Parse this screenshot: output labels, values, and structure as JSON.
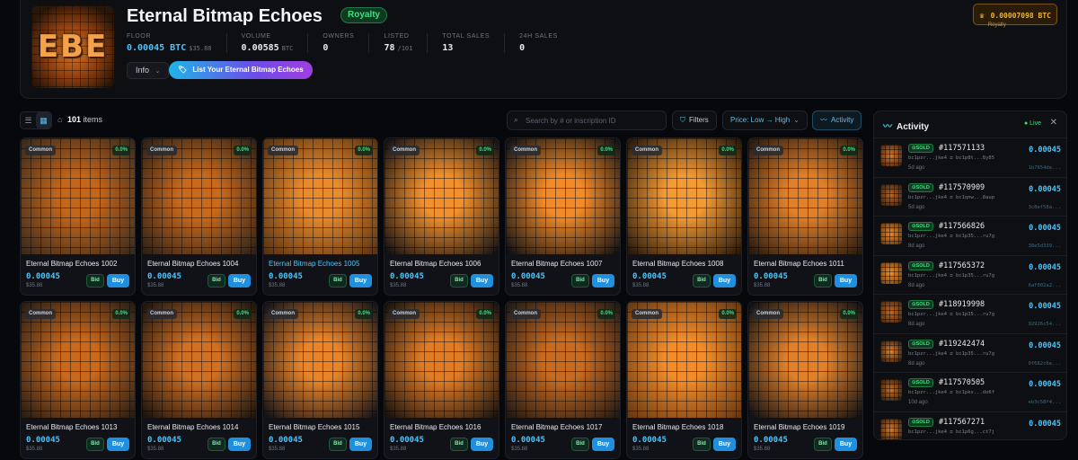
{
  "collection": {
    "title": "Eternal Bitmap Echoes",
    "logo_text": "EBE",
    "royalty_badge": "Royalty",
    "royalty_value": "0.00007098 BTC",
    "royalty_label": "Royalty",
    "info_label": "Info",
    "list_label": "List Your Eternal Bitmap Echoes"
  },
  "stats": [
    {
      "label": "FLOOR",
      "value": "0.00045 BTC",
      "sub": "$35.88"
    },
    {
      "label": "VOLUME",
      "value": "0.00585",
      "sub": "BTC"
    },
    {
      "label": "OWNERS",
      "value": "0",
      "sub": ""
    },
    {
      "label": "LISTED",
      "value": "78",
      "sub": "/101"
    },
    {
      "label": "TOTAL SALES",
      "value": "13",
      "sub": ""
    },
    {
      "label": "24H SALES",
      "value": "0",
      "sub": ""
    }
  ],
  "toolbar": {
    "items_count": "101",
    "items_suffix": "items",
    "search_placeholder": "Search by # or inscription ID",
    "filters_label": "Filters",
    "sort_label": "Price: Low → High",
    "activity_label": "Activity"
  },
  "colors": {
    "accent": "#4fc3f7",
    "green": "#3ee07e",
    "gold": "#f0b429"
  },
  "cards": [
    {
      "name": "Eternal Bitmap Echoes 1002",
      "rarity": "Common",
      "pct": "0.0%",
      "price": "0.00045",
      "usd": "$35.88",
      "bid": "Bid",
      "buy": "Buy",
      "highlight": false,
      "c1": "#c2661c",
      "c2": "#3a2a1c"
    },
    {
      "name": "Eternal Bitmap Echoes 1004",
      "rarity": "Common",
      "pct": "0.0%",
      "price": "0.00045",
      "usd": "$35.88",
      "bid": "Bid",
      "buy": "Buy",
      "highlight": false,
      "c1": "#c86a1e",
      "c2": "#2e2218"
    },
    {
      "name": "Eternal Bitmap Echoes 1005",
      "rarity": "Common",
      "pct": "0.0%",
      "price": "0.00045",
      "usd": "$35.88",
      "bid": "Bid",
      "buy": "Buy",
      "highlight": true,
      "c1": "#e88a2e",
      "c2": "#5a3412"
    },
    {
      "name": "Eternal Bitmap Echoes 1006",
      "rarity": "Common",
      "pct": "0.0%",
      "price": "0.00045",
      "usd": "$35.88",
      "bid": "Bid",
      "buy": "Buy",
      "highlight": false,
      "c1": "#f0902e",
      "c2": "#141214"
    },
    {
      "name": "Eternal Bitmap Echoes 1007",
      "rarity": "Common",
      "pct": "0.0%",
      "price": "0.00045",
      "usd": "$35.88",
      "bid": "Bid",
      "buy": "Buy",
      "highlight": false,
      "c1": "#f08a2a",
      "c2": "#121214"
    },
    {
      "name": "Eternal Bitmap Echoes 1008",
      "rarity": "Common",
      "pct": "0.0%",
      "price": "0.00045",
      "usd": "$35.88",
      "bid": "Bid",
      "buy": "Buy",
      "highlight": false,
      "c1": "#f29a36",
      "c2": "#2a1a0c"
    },
    {
      "name": "Eternal Bitmap Echoes 1011",
      "rarity": "Common",
      "pct": "0.0%",
      "price": "0.00045",
      "usd": "$35.88",
      "bid": "Bid",
      "buy": "Buy",
      "highlight": false,
      "c1": "#e0802a",
      "c2": "#2a1a10"
    },
    {
      "name": "Eternal Bitmap Echoes 1013",
      "rarity": "Common",
      "pct": "0.0%",
      "price": "0.00045",
      "usd": "$35.88",
      "bid": "Bid",
      "buy": "Buy",
      "highlight": false,
      "c1": "#c8691e",
      "c2": "#2a1e14"
    },
    {
      "name": "Eternal Bitmap Echoes 1014",
      "rarity": "Common",
      "pct": "0.0%",
      "price": "0.00045",
      "usd": "$35.88",
      "bid": "Bid",
      "buy": "Buy",
      "highlight": false,
      "c1": "#d07024",
      "c2": "#1e1610"
    },
    {
      "name": "Eternal Bitmap Echoes 1015",
      "rarity": "Common",
      "pct": "0.0%",
      "price": "0.00045",
      "usd": "$35.88",
      "bid": "Bid",
      "buy": "Buy",
      "highlight": false,
      "c1": "#e8842a",
      "c2": "#161418"
    },
    {
      "name": "Eternal Bitmap Echoes 1016",
      "rarity": "Common",
      "pct": "0.0%",
      "price": "0.00045",
      "usd": "$35.88",
      "bid": "Bid",
      "buy": "Buy",
      "highlight": false,
      "c1": "#e07c26",
      "c2": "#1a1410"
    },
    {
      "name": "Eternal Bitmap Echoes 1017",
      "rarity": "Common",
      "pct": "0.0%",
      "price": "0.00045",
      "usd": "$35.88",
      "bid": "Bid",
      "buy": "Buy",
      "highlight": false,
      "c1": "#c86a20",
      "c2": "#221a14"
    },
    {
      "name": "Eternal Bitmap Echoes 1018",
      "rarity": "Common",
      "pct": "0.0%",
      "price": "0.00045",
      "usd": "$35.88",
      "bid": "Bid",
      "buy": "Buy",
      "highlight": false,
      "c1": "#f08c2c",
      "c2": "#6a3a12"
    },
    {
      "name": "Eternal Bitmap Echoes 1019",
      "rarity": "Common",
      "pct": "0.0%",
      "price": "0.00045",
      "usd": "$35.88",
      "bid": "Bid",
      "buy": "Buy",
      "highlight": false,
      "c1": "#e0802a",
      "c2": "#121214"
    }
  ],
  "activity": {
    "title": "Activity",
    "live_label": "Live",
    "items": [
      {
        "status": "SOLD",
        "inscription": "#117571133",
        "addr": "bc1pzr...jke4 ⇄ bc1p8t...8y85",
        "ago": "5d ago",
        "price": "0.00045",
        "txid": "1b7654de...",
        "c1": "#d8772a",
        "c2": "#3a2010"
      },
      {
        "status": "SOLD",
        "inscription": "#117570909",
        "addr": "bc1pzr...jke4 ⇄ bc1qnw...8aup",
        "ago": "5d ago",
        "price": "0.00045",
        "txid": "3c8ef58a...",
        "c1": "#c06420",
        "c2": "#2a1e16"
      },
      {
        "status": "SOLD",
        "inscription": "#117566826",
        "addr": "bc1pzr...jke4 ⇄ bc1p35...ru7g",
        "ago": "8d ago",
        "price": "0.00045",
        "txid": "38e5d339...",
        "c1": "#e88a2e",
        "c2": "#5a3412"
      },
      {
        "status": "SOLD",
        "inscription": "#117565372",
        "addr": "bc1pzr...jke4 ⇄ bc1p35...ru7g",
        "ago": "8d ago",
        "price": "0.00045",
        "txid": "6af002a2...",
        "c1": "#f0902e",
        "c2": "#6a3a12"
      },
      {
        "status": "SOLD",
        "inscription": "#118919998",
        "addr": "bc1pzr...jke4 ⇄ bc1p35...ru7g",
        "ago": "8d ago",
        "price": "0.00045",
        "txid": "92926c54...",
        "c1": "#c8691e",
        "c2": "#3a2614"
      },
      {
        "status": "SOLD",
        "inscription": "#119242474",
        "addr": "bc1pzr...jke4 ⇄ bc1p35...ru7g",
        "ago": "8d ago",
        "price": "0.00045",
        "txid": "0f682c6e...",
        "c1": "#e8842a",
        "c2": "#161418"
      },
      {
        "status": "SOLD",
        "inscription": "#117570505",
        "addr": "bc1pzr...jke4 ⇄ bc1pkv...do6f",
        "ago": "10d ago",
        "price": "0.00045",
        "txid": "eb3c58f4...",
        "c1": "#d07024",
        "c2": "#1e1610"
      },
      {
        "status": "SOLD",
        "inscription": "#117567271",
        "addr": "bc1pzr...jke4 ⇄ bc1p6g...ct7j",
        "ago": "",
        "price": "0.00045",
        "txid": "",
        "c1": "#e07c26",
        "c2": "#2a1a10"
      }
    ]
  }
}
